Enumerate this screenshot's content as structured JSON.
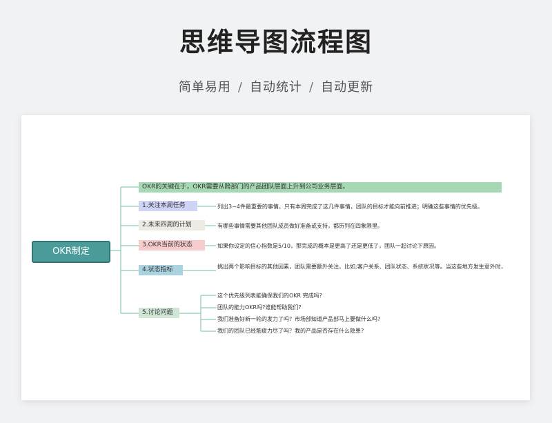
{
  "header": {
    "title": "思维导图流程图",
    "features": [
      "简单易用",
      "自动统计",
      "自动更新"
    ],
    "separator": "/"
  },
  "mindmap": {
    "root": "OKR制定",
    "branches": [
      {
        "label": "OKR的关键在于，OKR需要从跨部门的产品团队层面上升到公司业务层面。",
        "color": "#a6d9b3",
        "details": []
      },
      {
        "label": "1.关注本周任务",
        "color": "#cfd3f5",
        "details": [
          "列出3~4件最重要的事情，只有本周完成了这几件事情，团队的目标才能向前推进；明确这些事情的优先级。"
        ]
      },
      {
        "label": "2.未来四周的计划",
        "color": "#ecebe4",
        "details": [
          "有哪些事情需要其他团队成员做好准备或支持，都历列在四象限里。"
        ]
      },
      {
        "label": "3.OKR当前的状态",
        "color": "#f7cccc",
        "details": [
          "如果你设定的信心指数是5/10，那完成的概本是更高了还是更低了，团队一起讨论下原因。"
        ]
      },
      {
        "label": "4.状态指标",
        "color": "#a9d3e0",
        "details": [
          "挑出两个影响目标的其他因素，团队需要额外关注，比如;客户关系、团队状态、系统状况等。当这些地方发生意外时，"
        ]
      },
      {
        "label": "5.讨论问题",
        "color": "#cfe6d5",
        "details": [
          "这个优先级列表能确保我们的OKR 完成吗?",
          "团队的能力OKR吗?谁能帮助我们?",
          "我们准备好新一轮的发力了吗？市场部知道产品部马上要做什么吗?",
          "我们的团队已经筋疲力尽了吗？我的产品是否存在什么隐患?"
        ]
      }
    ]
  },
  "colors": {
    "line": "#8fc9ae",
    "root_fill": "#4a9b9a",
    "root_border": "#2f7776"
  }
}
